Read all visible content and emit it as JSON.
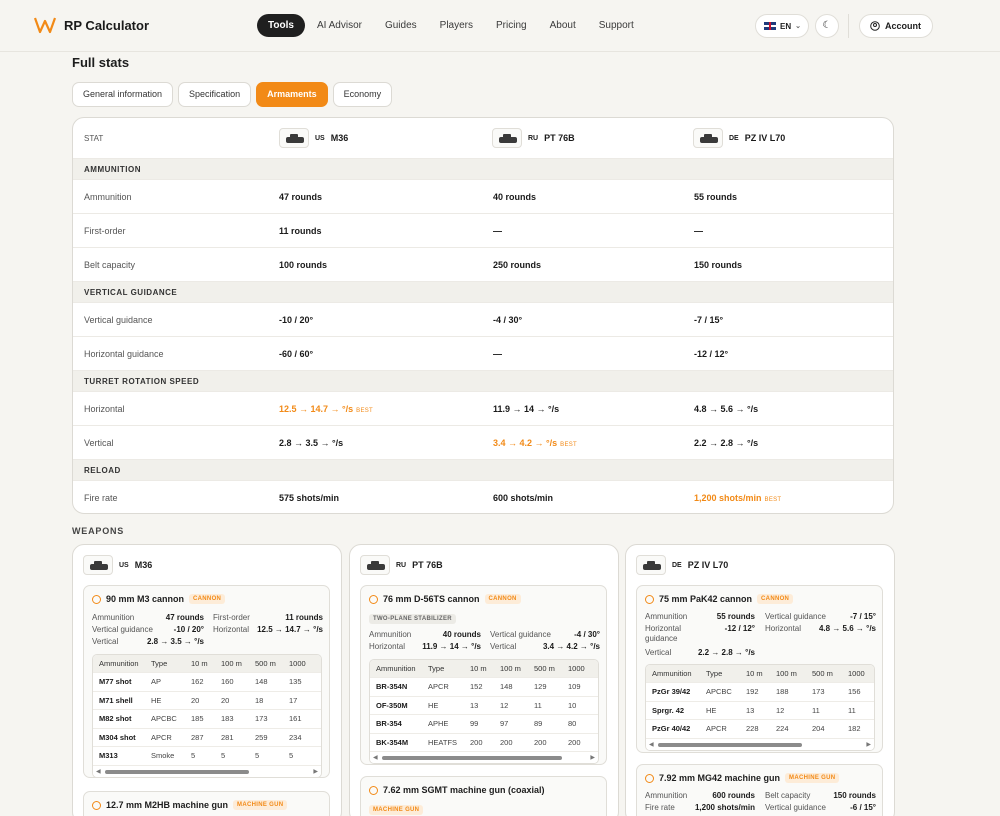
{
  "app": {
    "name": "RP Calculator"
  },
  "nav": [
    "Tools",
    "AI Advisor",
    "Guides",
    "Players",
    "Pricing",
    "About",
    "Support"
  ],
  "lang": "EN",
  "account": "Account",
  "title": "Full stats",
  "tabs": [
    "General information",
    "Specification",
    "Armaments",
    "Economy"
  ],
  "stat_header": "STAT",
  "vehicles": [
    {
      "nation": "US",
      "name": "M36"
    },
    {
      "nation": "RU",
      "name": "PT 76B"
    },
    {
      "nation": "DE",
      "name": "PZ IV L70"
    }
  ],
  "best": "BEST",
  "sections": [
    {
      "title": "AMMUNITION",
      "rows": [
        {
          "label": "Ammunition",
          "v": [
            "47 rounds",
            "40 rounds",
            "55 rounds"
          ]
        },
        {
          "label": "First-order",
          "v": [
            "11 rounds",
            "—",
            "—"
          ]
        },
        {
          "label": "Belt capacity",
          "v": [
            "100 rounds",
            "250 rounds",
            "150 rounds"
          ]
        }
      ]
    },
    {
      "title": "VERTICAL GUIDANCE",
      "rows": [
        {
          "label": "Vertical guidance",
          "v": [
            "-10 / 20°",
            "-4 / 30°",
            "-7 / 15°"
          ]
        },
        {
          "label": "Horizontal guidance",
          "v": [
            "-60 / 60°",
            "—",
            "-12 / 12°"
          ]
        }
      ]
    },
    {
      "title": "TURRET ROTATION SPEED",
      "rows": [
        {
          "label": "Horizontal",
          "v": [
            "12.5 → 14.7 → °/s",
            "11.9 → 14 → °/s",
            "4.8 → 5.6 → °/s"
          ]
        },
        {
          "label": "Vertical",
          "v": [
            "2.8 → 3.5 → °/s",
            "3.4 → 4.2 → °/s",
            "2.2 → 2.8 → °/s"
          ]
        }
      ]
    },
    {
      "title": "RELOAD",
      "rows": [
        {
          "label": "Fire rate",
          "v": [
            "575 shots/min",
            "600 shots/min",
            "1,200 shots/min"
          ]
        }
      ]
    }
  ],
  "weapons_label": "WEAPONS",
  "cols": [
    "Ammunition",
    "Type",
    "10 m",
    "100 m",
    "500 m",
    "1000"
  ],
  "cards": [
    {
      "nation": "US",
      "name": "M36",
      "gun": {
        "name": "90 mm M3 cannon",
        "tag": "CANNON",
        "kv": [
          [
            "Ammunition",
            "47 rounds"
          ],
          [
            "First-order",
            "11 rounds"
          ],
          [
            "Vertical guidance",
            "-10 / 20°"
          ],
          [
            "Horizontal",
            "12.5 → 14.7 → °/s"
          ],
          [
            "Vertical",
            "2.8 → 3.5 → °/s"
          ]
        ],
        "rows": [
          [
            "M77 shot",
            "AP",
            "162",
            "160",
            "148",
            "135"
          ],
          [
            "M71 shell",
            "HE",
            "20",
            "20",
            "18",
            "17"
          ],
          [
            "M82 shot",
            "APCBC",
            "185",
            "183",
            "173",
            "161"
          ],
          [
            "M304 shot",
            "APCR",
            "287",
            "281",
            "259",
            "234"
          ],
          [
            "M313",
            "Smoke",
            "5",
            "5",
            "5",
            "5"
          ]
        ]
      },
      "gun2": {
        "name": "12.7 mm M2HB machine gun",
        "tag": "MACHINE GUN"
      }
    },
    {
      "nation": "RU",
      "name": "PT 76B",
      "gun": {
        "name": "76 mm D-56TS cannon",
        "tag": "CANNON",
        "tag2": "TWO-PLANE STABILIZER",
        "kv": [
          [
            "Ammunition",
            "40 rounds"
          ],
          [
            "Vertical guidance",
            "-4 / 30°"
          ],
          [
            "Horizontal",
            "11.9 → 14 → °/s"
          ],
          [
            "Vertical",
            "3.4 → 4.2 → °/s"
          ]
        ],
        "rows": [
          [
            "BR-354N",
            "APCR",
            "152",
            "148",
            "129",
            "109"
          ],
          [
            "OF-350M",
            "HE",
            "13",
            "12",
            "11",
            "10"
          ],
          [
            "BR-354",
            "APHE",
            "99",
            "97",
            "89",
            "80"
          ],
          [
            "BK-354M",
            "HEATFS",
            "200",
            "200",
            "200",
            "200"
          ]
        ]
      },
      "gun2": {
        "name": "7.62 mm SGMT machine gun (coaxial)",
        "tag": "MACHINE GUN"
      }
    },
    {
      "nation": "DE",
      "name": "PZ IV L70",
      "gun": {
        "name": "75 mm PaK42 cannon",
        "tag": "CANNON",
        "kv": [
          [
            "Ammunition",
            "55 rounds"
          ],
          [
            "Vertical guidance",
            "-7 / 15°"
          ],
          [
            "Horizontal guidance",
            "-12 / 12°"
          ],
          [
            "Horizontal",
            "4.8 → 5.6 → °/s"
          ],
          [
            "Vertical",
            "2.2 → 2.8 → °/s"
          ]
        ],
        "rows": [
          [
            "PzGr 39/42",
            "APCBC",
            "192",
            "188",
            "173",
            "156"
          ],
          [
            "Sprgr. 42",
            "HE",
            "13",
            "12",
            "11",
            "11"
          ],
          [
            "PzGr 40/42",
            "APCR",
            "228",
            "224",
            "204",
            "182"
          ]
        ]
      },
      "gun2": {
        "name": "7.92 mm MG42 machine gun",
        "tag": "MACHINE GUN",
        "kv": [
          [
            "Ammunition",
            "600 rounds"
          ],
          [
            "Belt capacity",
            "150 rounds"
          ],
          [
            "Fire rate",
            "1,200 shots/min"
          ],
          [
            "Vertical guidance",
            "-6 / 15°"
          ]
        ]
      }
    }
  ]
}
